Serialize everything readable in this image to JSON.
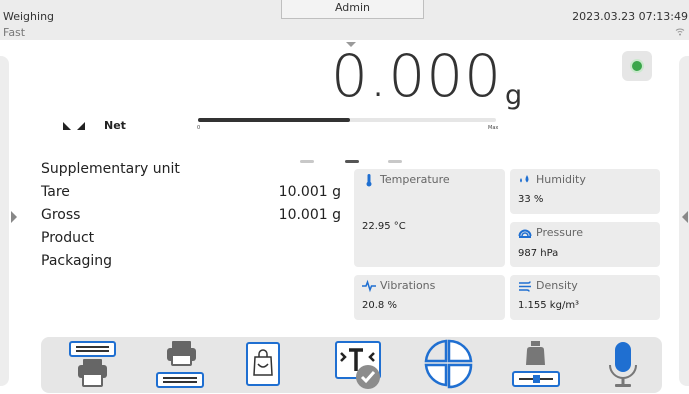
{
  "status": {
    "mode": "Weighing",
    "submode": "Fast",
    "user": "Admin",
    "datetime": "2023.03.23 07:13:49"
  },
  "reading": {
    "value": "0.000",
    "unit": "g",
    "status_label": "Net",
    "range_min": "0",
    "range_max": "Max",
    "bar_fill_fraction": 0.51
  },
  "info_rows": [
    {
      "label": "Supplementary unit",
      "value": ""
    },
    {
      "label": "Tare",
      "value": "10.001 g"
    },
    {
      "label": "Gross",
      "value": "10.001 g"
    },
    {
      "label": "Product",
      "value": ""
    },
    {
      "label": "Packaging",
      "value": ""
    }
  ],
  "pager": {
    "pages": 3,
    "active": 1
  },
  "widgets": {
    "temperature": {
      "title": "Temperature",
      "value": "22.95 °C",
      "icon": "thermometer-icon"
    },
    "humidity": {
      "title": "Humidity",
      "value": "33 %",
      "icon": "droplets-icon"
    },
    "pressure": {
      "title": "Pressure",
      "value": "987 hPa",
      "icon": "gauge-icon"
    },
    "vibrations": {
      "title": "Vibrations",
      "value": "20.8 %",
      "icon": "vibration-icon"
    },
    "density": {
      "title": "Density",
      "value": "1.155 kg/m³",
      "icon": "density-icon"
    }
  },
  "toolbar_icons": [
    "print-header-icon",
    "print-footer-icon",
    "packaging-icon",
    "tare-check-icon",
    "statistics-icon",
    "adjustment-icon",
    "voice-icon"
  ],
  "colors": {
    "accent": "#1f6fd1",
    "ok": "#3aa64a",
    "panel": "#ececec"
  }
}
